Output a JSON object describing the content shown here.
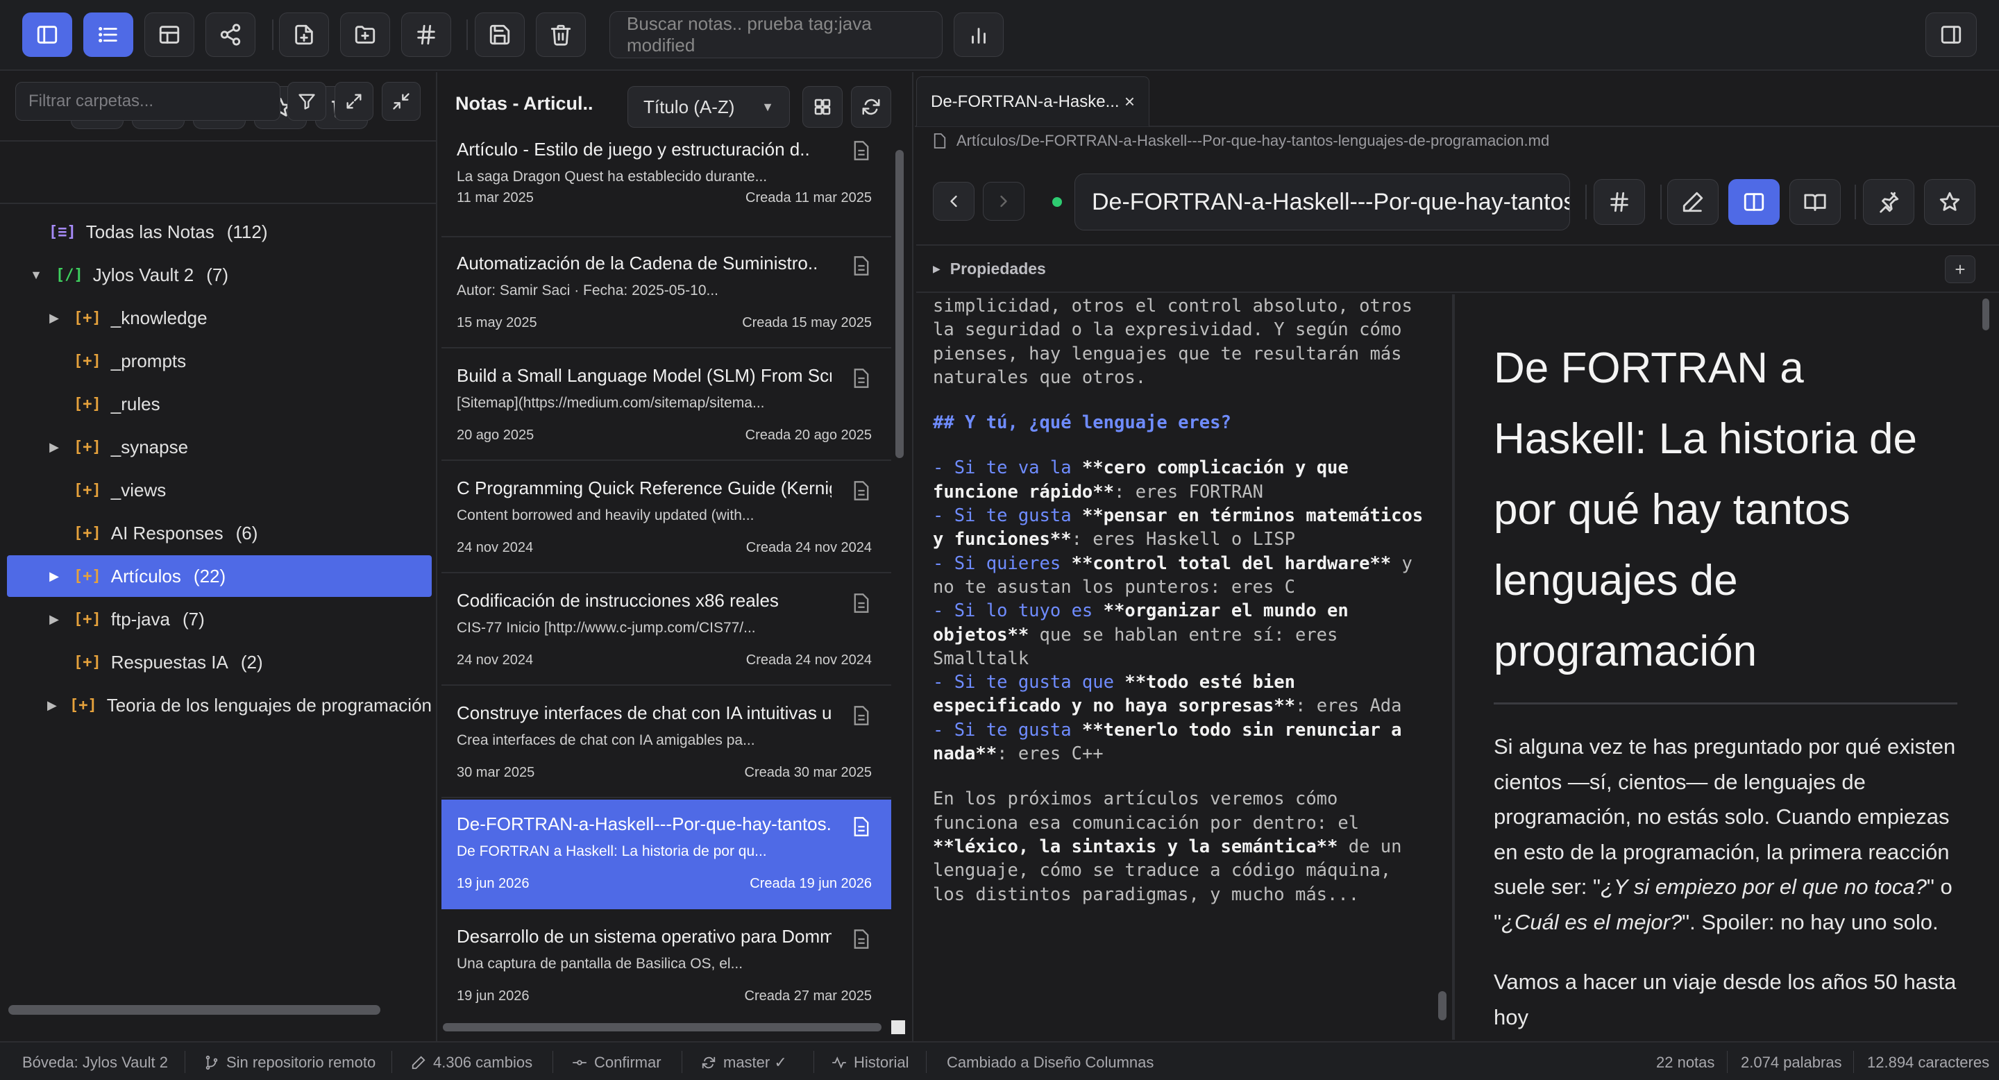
{
  "toolbar": {
    "search_placeholder": "Buscar notas.. prueba tag:java modified"
  },
  "folders": {
    "filter_placeholder": "Filtrar carpetas...",
    "items": [
      {
        "label": "Todas las Notas",
        "count": "(112)",
        "icon": "[≡]"
      },
      {
        "label": "Jylos Vault 2",
        "count": "(7)",
        "icon": "[/]"
      },
      {
        "label": "_knowledge",
        "count": "",
        "icon": "[+]"
      },
      {
        "label": "_prompts",
        "count": "",
        "icon": "[+]"
      },
      {
        "label": "_rules",
        "count": "",
        "icon": "[+]"
      },
      {
        "label": "_synapse",
        "count": "",
        "icon": "[+]"
      },
      {
        "label": "_views",
        "count": "",
        "icon": "[+]"
      },
      {
        "label": "AI Responses",
        "count": "(6)",
        "icon": "[+]"
      },
      {
        "label": "Artículos",
        "count": "(22)",
        "icon": "[+]"
      },
      {
        "label": "ftp-java",
        "count": "(7)",
        "icon": "[+]"
      },
      {
        "label": "Respuestas IA",
        "count": "(2)",
        "icon": "[+]"
      },
      {
        "label": "Teoria de los lenguajes de programación",
        "count": "",
        "icon": "[+]"
      }
    ]
  },
  "notes": {
    "title": "Notas - Articul..",
    "sort_label": "Título (A-Z)",
    "items": [
      {
        "title": "Artículo - Estilo de juego y estructuración d..",
        "excerpt": "La saga Dragon Quest ha establecido durante...",
        "date": "11 mar 2025",
        "created": "Creada 11 mar 2025"
      },
      {
        "title": "Automatización de la Cadena de Suministro..",
        "excerpt": "Autor: Samir Saci · Fecha: 2025-05-10...",
        "date": "15 may 2025",
        "created": "Creada 15 may 2025"
      },
      {
        "title": "Build a Small Language Model (SLM) From Scrat..",
        "excerpt": "[Sitemap](https://medium.com/sitemap/sitema...",
        "date": "20 ago 2025",
        "created": "Creada 20 ago 2025"
      },
      {
        "title": "C Programming Quick Reference Guide (Kernigh..",
        "excerpt": "Content borrowed and heavily updated (with...",
        "date": "24 nov 2024",
        "created": "Creada 24 nov 2024"
      },
      {
        "title": "Codificación de instrucciones x86 reales",
        "excerpt": "CIS-77 Inicio [http://www.c-jump.com/CIS77/...",
        "date": "24 nov 2024",
        "created": "Creada 24 nov 2024"
      },
      {
        "title": "Construye interfaces de chat con IA intuitivas us..",
        "excerpt": "Crea interfaces de chat con IA amigables pa...",
        "date": "30 mar 2025",
        "created": "Creada 30 mar 2025"
      },
      {
        "title": "De-FORTRAN-a-Haskell---Por-que-hay-tantos..",
        "excerpt": "De FORTRAN a Haskell: La historia de por qu...",
        "date": "19 jun 2026",
        "created": "Creada 19 jun 2026"
      },
      {
        "title": "Desarrollo de un sistema operativo para Dommies",
        "excerpt": "Una captura de pantalla de Basilica OS, el...",
        "date": "19 jun 2026",
        "created": "Creada 27 mar 2025"
      }
    ]
  },
  "editor": {
    "tab_label": "De-FORTRAN-a-Haske...",
    "filepath": "Artículos/De-FORTRAN-a-Haskell---Por-que-hay-tantos-lenguajes-de-programacion.md",
    "title_value": "De-FORTRAN-a-Haskell---Por-que-hay-tantos-lenguajes-de-programacion",
    "properties_label": "Propiedades",
    "source": {
      "p1": "simplicidad, otros el control absoluto, otros la seguridad o la expresividad. Y según cómo pienses, hay lenguajes que te resultarán más naturales que otros.",
      "h2": "## Y tú, ¿qué lenguaje eres?",
      "l1a": "- Si te va la ",
      "l1b": "**cero complicación y que funcione rápido**",
      "l1c": ": eres FORTRAN",
      "l2a": "- Si te gusta ",
      "l2b": "**pensar en términos matemáticos y funciones**",
      "l2c": ": eres Haskell o LISP",
      "l3a": "- Si quieres ",
      "l3b": "**control total del hardware**",
      "l3c": " y no te asustan los punteros: eres C",
      "l4a": "- Si lo tuyo es ",
      "l4b": "**organizar el mundo en objetos**",
      "l4c": " que se hablan entre sí: eres Smalltalk",
      "l5a": "- Si te gusta que ",
      "l5b": "**todo esté bien especificado y no haya sorpresas**",
      "l5c": ": eres Ada",
      "l6a": "- Si te gusta ",
      "l6b": "**tenerlo todo sin renunciar a nada**",
      "l6c": ": eres C++",
      "p2a": "En los próximos artículos veremos cómo funciona esa comunicación por dentro: el ",
      "p2b": "**léxico, la sintaxis y la semántica**",
      "p2c": " de un lenguaje, cómo se traduce a código máquina, los distintos paradigmas, y mucho más..."
    },
    "preview": {
      "heading": "De FORTRAN a Haskell: La historia de por qué hay tantos lenguajes de programación",
      "p1a": "Si alguna vez te has preguntado por qué existen cientos —sí, cientos— de lenguajes de programación, no estás solo. Cuando empiezas en esto de la programación, la primera reacción suele ser: \"",
      "p1b": "¿Y si empiezo por el que no toca?",
      "p1c": "\" o \"",
      "p1d": "¿Cuál es el mejor?",
      "p1e": "\". Spoiler: no hay uno solo.",
      "p2": "Vamos a hacer un viaje desde los años 50 hasta hoy"
    }
  },
  "statusbar": {
    "vault": "Bóveda: Jylos Vault 2",
    "repo": "Sin repositorio remoto",
    "changes": "4.306 cambios",
    "commit": "Confirmar",
    "branch": "master ✓",
    "history": "Historial",
    "message": "Cambiado a Diseño Columnas",
    "notes_count": "22 notas",
    "words": "2.074 palabras",
    "chars": "12.894 caracteres"
  },
  "colors": {
    "accent": "#4f6ae6",
    "background": "#1c1c1e",
    "folder_icon": "#e6a23c",
    "heading_md": "#6f8cff",
    "status_dot": "#2ecc71"
  }
}
